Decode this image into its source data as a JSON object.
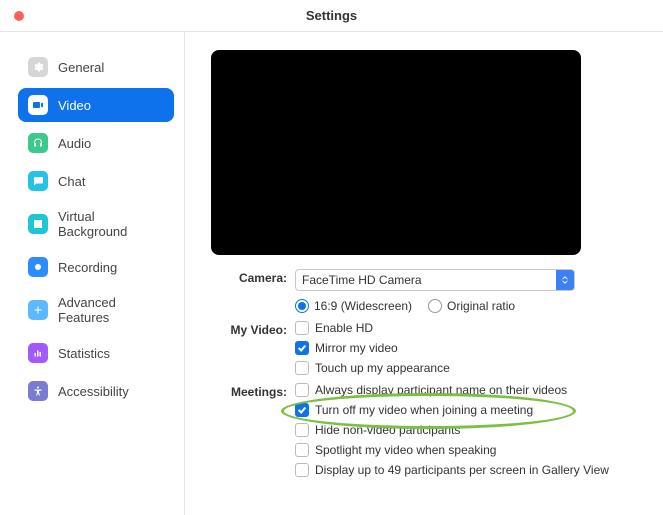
{
  "window_title": "Settings",
  "sidebar": {
    "items": [
      {
        "label": "General"
      },
      {
        "label": "Video"
      },
      {
        "label": "Audio"
      },
      {
        "label": "Chat"
      },
      {
        "label": "Virtual Background"
      },
      {
        "label": "Recording"
      },
      {
        "label": "Advanced Features"
      },
      {
        "label": "Statistics"
      },
      {
        "label": "Accessibility"
      }
    ]
  },
  "settings": {
    "camera_label": "Camera:",
    "camera_value": "FaceTime HD Camera",
    "aspect": {
      "widescreen": "16:9 (Widescreen)",
      "original": "Original ratio"
    },
    "myvideo_label": "My Video:",
    "myvideo": {
      "enable_hd": "Enable HD",
      "mirror": "Mirror my video",
      "touchup": "Touch up my appearance"
    },
    "meetings_label": "Meetings:",
    "meetings": {
      "always_names": "Always display participant name on their videos",
      "turnoff_video": "Turn off my video when joining a meeting",
      "hide_nonvideo": "Hide non-video participants",
      "spotlight": "Spotlight my video when speaking",
      "gallery49": "Display up to 49 participants per screen in Gallery View"
    }
  }
}
